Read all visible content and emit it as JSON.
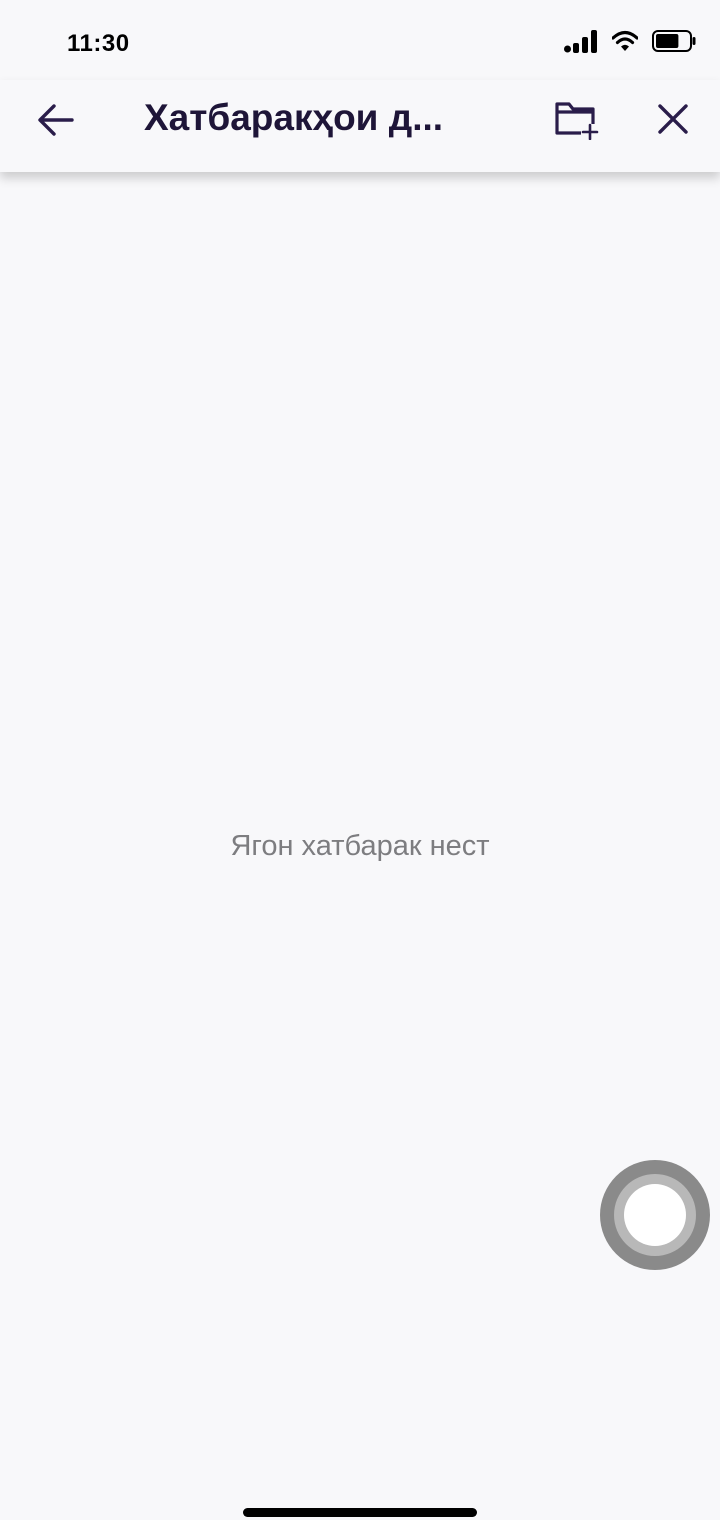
{
  "status_bar": {
    "time": "11:30",
    "signal_icon": "cellular-signal-icon",
    "wifi_icon": "wifi-icon",
    "battery_icon": "battery-icon",
    "battery_level": 0.7
  },
  "header": {
    "title": "Хатбаракҳои д...",
    "back_icon": "arrow-left-icon",
    "new_folder_icon": "folder-plus-icon",
    "close_icon": "close-icon"
  },
  "main": {
    "empty_text": "Ягон хатбарак нест"
  },
  "colors": {
    "background": "#f8f8fa",
    "header_text": "#1e1538",
    "icon": "#2a1d4a",
    "empty_text": "#7d7d80"
  }
}
